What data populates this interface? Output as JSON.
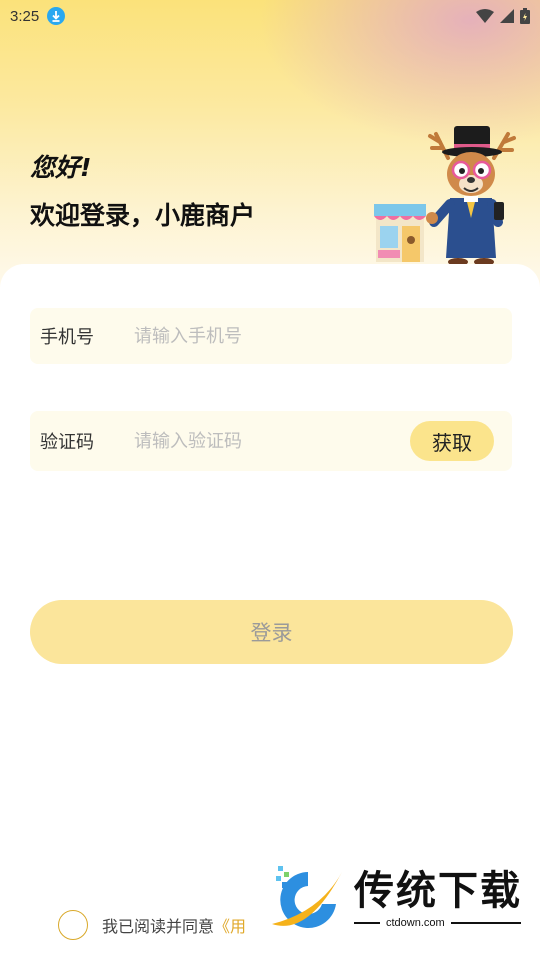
{
  "status_bar": {
    "time": "3:25",
    "icons": [
      "download-icon",
      "wifi-icon",
      "signal-icon",
      "battery-icon"
    ]
  },
  "header": {
    "greeting": "您好!",
    "welcome": "欢迎登录，小鹿商户"
  },
  "form": {
    "phone": {
      "label": "手机号",
      "placeholder": "请输入手机号",
      "value": ""
    },
    "code": {
      "label": "验证码",
      "placeholder": "请输入验证码",
      "value": "",
      "get_button": "获取"
    }
  },
  "login_button": "登录",
  "agreement": {
    "checked": false,
    "text": "我已阅读并同意",
    "link": "《用"
  },
  "watermark": {
    "title": "传统下载",
    "subtitle": "ctdown.com"
  },
  "colors": {
    "accent_yellow": "#fbe48c",
    "link_gold": "#e0a92b",
    "field_bg": "#fefbec"
  }
}
